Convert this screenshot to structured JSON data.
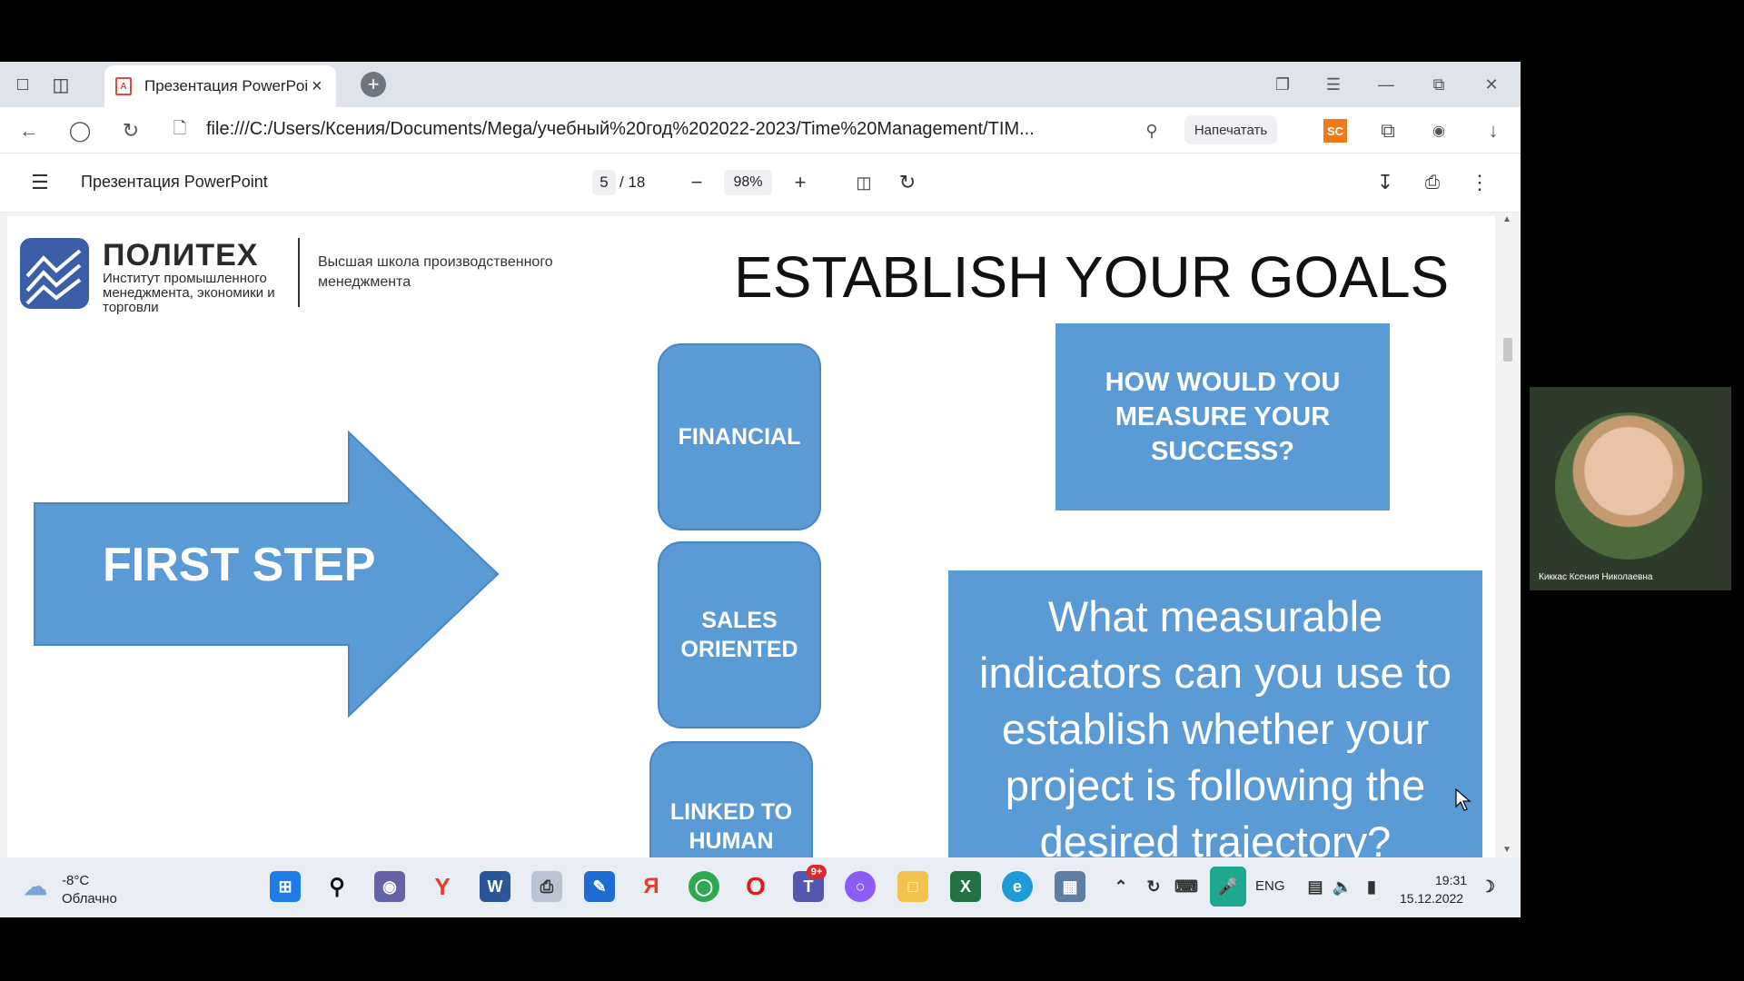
{
  "browser": {
    "tab_title": "Презентация PowerPoi",
    "url": "file:///C:/Users/Ксения/Documents/Mega/учебный%20год%202022-2023/Time%20Management/TIM...",
    "print_button": "Напечатать",
    "sc_label": "SC"
  },
  "pdf_toolbar": {
    "title": "Презентация PowerPoint",
    "page_current": "5",
    "page_total": "/ 18",
    "zoom": "98%"
  },
  "slide": {
    "logo_name": "ПОЛИТЕХ",
    "logo_subtitle": "Институт промышленного менеджмента, экономики и торговли",
    "logo_school": "Высшая школа производственного менеджмента",
    "title": "ESTABLISH YOUR GOALS",
    "arrow_label": "FIRST STEP",
    "pill_financial": "FINANCIAL",
    "pill_sales": "SALES ORIENTED",
    "pill_human": "LINKED TO HUMAN",
    "box_measure": "HOW WOULD YOU MEASURE YOUR SUCCESS?",
    "box_indicators": "What measurable indicators can you use to establish whether your project is following the desired trajectory?"
  },
  "webcam": {
    "participant_name": "Киккас Ксения Николаевна"
  },
  "taskbar": {
    "weather_temp": "-8°C",
    "weather_desc": "Облачно",
    "language": "ENG",
    "time": "19:31",
    "date": "15.12.2022",
    "teams_badge": "9+"
  },
  "colors": {
    "slide_blue": "#5b9bd5",
    "logo_blue": "#3a5ea8"
  }
}
